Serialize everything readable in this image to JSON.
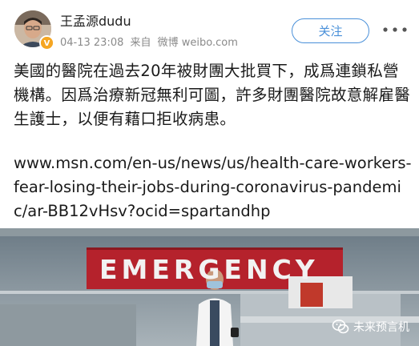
{
  "header": {
    "username": "王孟源dudu",
    "date": "04-13 23:08",
    "source_prefix": "来自",
    "source_name": "微博 weibo.com",
    "follow_label": "关注",
    "more_icon": "more-dots-icon",
    "verified_icon": "verified-badge-icon"
  },
  "post": {
    "text": "美國的醫院在過去20年被財團大批買下，成爲連鎖私營機構。因爲治療新冠無利可圖，許多財團醫院故意解雇醫生護士，以便有藉口拒收病患。",
    "link": "www.msn.com/en-us/news/us/health-care-workers-fear-losing-their-jobs-during-coronavirus-pandemic/ar-BB12vHsv?ocid=spartandhp"
  },
  "image": {
    "sign_text": "EMERGENCY",
    "watermark_text": "未来预言机",
    "watermark_icon": "wechat-icon"
  },
  "colors": {
    "accent": "#4a90d9",
    "meta": "#8a8a8a",
    "verified": "#f5a623"
  }
}
